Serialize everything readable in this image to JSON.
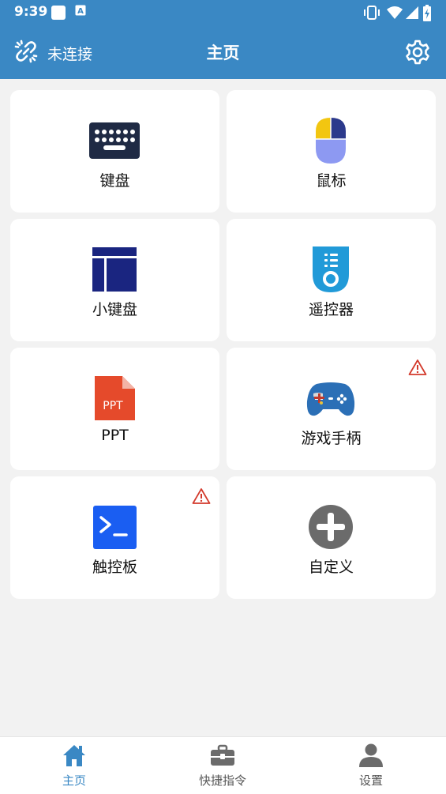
{
  "status_bar": {
    "time": "9:39",
    "icons": [
      "square-notification-icon",
      "a-notification-icon",
      "vibrate-icon",
      "wifi-icon",
      "signal-icon",
      "battery-icon"
    ]
  },
  "app_bar": {
    "connection_status": "未连接",
    "title": "主页",
    "icons": [
      "unlinked-icon",
      "settings-gear-icon"
    ]
  },
  "tiles": [
    {
      "label": "键盘",
      "icon": "keyboard-icon",
      "warning": false
    },
    {
      "label": "鼠标",
      "icon": "mouse-icon",
      "warning": false
    },
    {
      "label": "小键盘",
      "icon": "numpad-icon",
      "warning": false
    },
    {
      "label": "遥控器",
      "icon": "remote-icon",
      "warning": false
    },
    {
      "label": "PPT",
      "icon": "ppt-icon",
      "icon_text": "PPT",
      "warning": false
    },
    {
      "label": "游戏手柄",
      "icon": "gamepad-icon",
      "warning": true
    },
    {
      "label": "触控板",
      "icon": "terminal-icon",
      "warning": true
    },
    {
      "label": "自定义",
      "icon": "add-circle-icon",
      "warning": false
    }
  ],
  "bottom_nav": [
    {
      "label": "主页",
      "icon": "home-icon",
      "active": true
    },
    {
      "label": "快捷指令",
      "icon": "toolbox-icon",
      "active": false
    },
    {
      "label": "设置",
      "icon": "person-icon",
      "active": false
    }
  ],
  "colors": {
    "primary": "#3a88c4",
    "warning": "#d33a2c",
    "background": "#f2f2f2",
    "card": "#ffffff"
  }
}
